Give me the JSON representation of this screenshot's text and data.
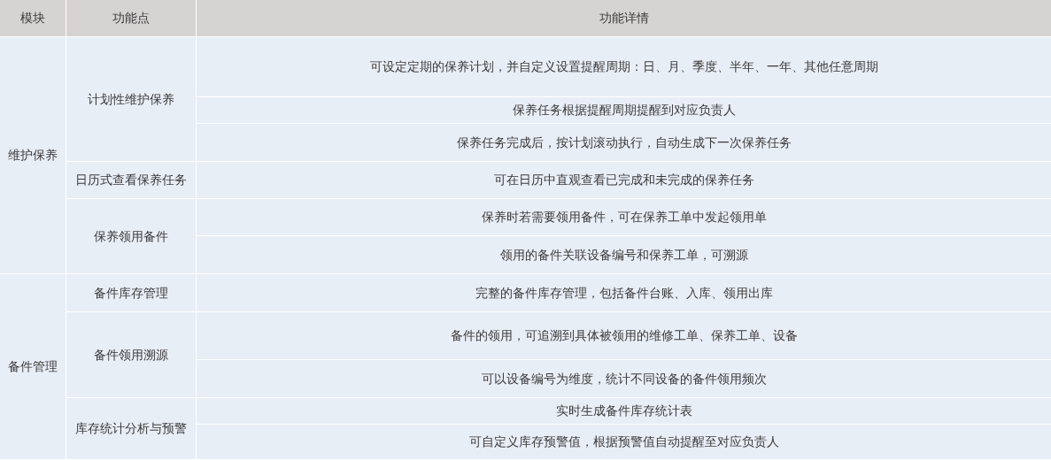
{
  "table": {
    "columns": [
      "模块",
      "功能点",
      "功能详情"
    ],
    "modules": [
      {
        "name": "维护保养",
        "features": [
          {
            "name": "计划性维护保养",
            "details": [
              "可设定定期的保养计划，并自定义设置提醒周期：日、月、季度、半年、一年、其他任意周期",
              "保养任务根据提醒周期提醒到对应负责人",
              "保养任务完成后，按计划滚动执行，自动生成下一次保养任务"
            ]
          },
          {
            "name": "日历式查看保养任务",
            "details": [
              "可在日历中直观查看已完成和未完成的保养任务"
            ]
          },
          {
            "name": "保养领用备件",
            "details": [
              "保养时若需要领用备件，可在保养工单中发起领用单",
              "领用的备件关联设备编号和保养工单，可溯源"
            ]
          }
        ]
      },
      {
        "name": "备件管理",
        "features": [
          {
            "name": "备件库存管理",
            "details": [
              "完整的备件库存管理，包括备件台账、入库、领用出库"
            ]
          },
          {
            "name": "备件领用溯源",
            "details": [
              "备件的领用，可追溯到具体被领用的维修工单、保养工单、设备",
              "可以设备编号为维度，统计不同设备的备件领用频次"
            ]
          },
          {
            "name": "库存统计分析与预警",
            "details": [
              "实时生成备件库存统计表",
              "可自定义库存预警值，根据预警值自动提醒至对应负责人"
            ]
          }
        ]
      }
    ]
  }
}
